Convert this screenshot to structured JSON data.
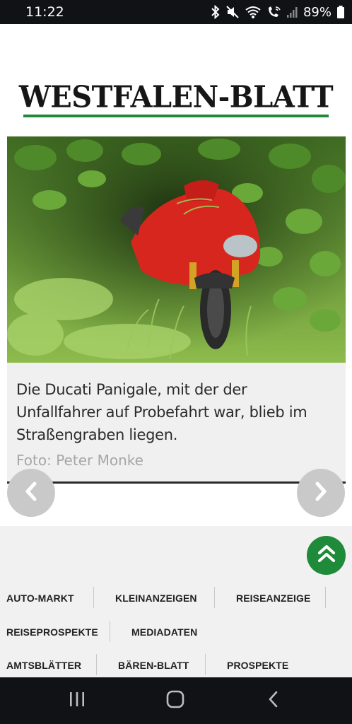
{
  "status_bar": {
    "time": "11:22",
    "battery": "89%",
    "icons": [
      "bluetooth-icon",
      "mute-icon",
      "wifi-icon",
      "wifi-call-icon",
      "signal-icon",
      "battery-icon"
    ]
  },
  "masthead": {
    "logo": "WESTFALEN-BLATT",
    "accent_color": "#1f8a3a"
  },
  "article_image": {
    "caption": "Die Ducati Panigale, mit der der Unfallfahrer auf Probefahrt war, blieb im Straßengraben liegen.",
    "credit": "Foto: Peter Monke"
  },
  "gallery_nav": {
    "prev_icon": "chevron-left-icon",
    "next_icon": "chevron-right-icon"
  },
  "footer": {
    "scroll_top_icon": "double-chevron-up-icon",
    "links": [
      "AUTO-MARKT",
      "KLEINANZEIGEN",
      "REISEANZEIGE",
      "REISEPROSPEKTE",
      "MEDIADATEN",
      "AMTSBLÄTTER",
      "BÄREN-BLATT",
      "PROSPEKTE"
    ]
  },
  "system_nav": {
    "icons": [
      "recent-apps-icon",
      "home-icon",
      "back-icon"
    ]
  }
}
